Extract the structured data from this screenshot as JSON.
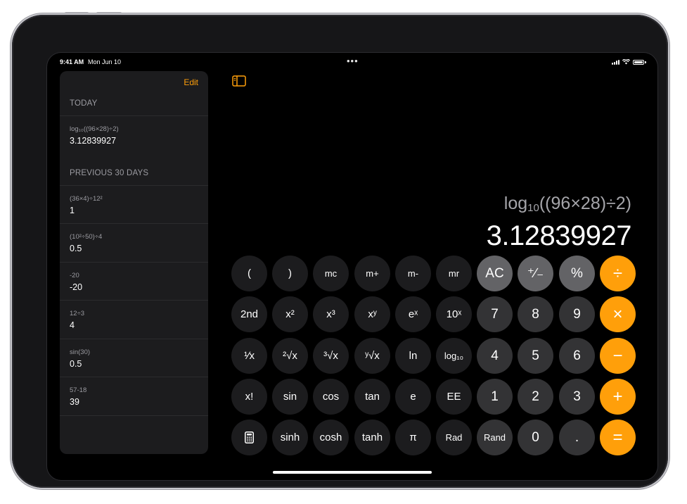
{
  "status_bar": {
    "time": "9:41 AM",
    "date": "Mon Jun 10"
  },
  "sidebar": {
    "edit_label": "Edit",
    "sections": [
      {
        "title": "TODAY",
        "items": [
          {
            "expression": "log₁₀((96×28)÷2)",
            "result": "3.12839927"
          }
        ]
      },
      {
        "title": "PREVIOUS 30 DAYS",
        "items": [
          {
            "expression": "(36×4)÷12²",
            "result": "1"
          },
          {
            "expression": "(10²÷50)÷4",
            "result": "0.5"
          },
          {
            "expression": "-20",
            "result": "-20"
          },
          {
            "expression": "12÷3",
            "result": "4"
          },
          {
            "expression": "sin(30)",
            "result": "0.5"
          },
          {
            "expression": "57-18",
            "result": "39"
          }
        ]
      }
    ]
  },
  "display": {
    "expression_main": "log",
    "expression_sub": "10",
    "expression_rest": "((96×28)÷2)",
    "result": "3.12839927"
  },
  "keypad": {
    "rows": [
      [
        "(",
        ")",
        "mc",
        "m+",
        "m-",
        "mr",
        "AC",
        "⁺∕₋",
        "%",
        "÷"
      ],
      [
        "2nd",
        "x²",
        "x³",
        "xʸ",
        "eˣ",
        "10ˣ",
        "7",
        "8",
        "9",
        "×"
      ],
      [
        "¹∕x",
        "²√x",
        "³√x",
        "ʸ√x",
        "ln",
        "log₁₀",
        "4",
        "5",
        "6",
        "−"
      ],
      [
        "x!",
        "sin",
        "cos",
        "tan",
        "e",
        "EE",
        "1",
        "2",
        "3",
        "+"
      ],
      [
        "",
        "sinh",
        "cosh",
        "tanh",
        "π",
        "Rad",
        "Rand",
        "0",
        ".",
        "="
      ]
    ]
  },
  "colors": {
    "accent": "#ff9f0a",
    "function_key": "#636366",
    "digit_key": "#333335",
    "scientific_key": "#1c1c1e",
    "sidebar_bg": "#1c1c1e"
  },
  "icons": {
    "sidebar_toggle": "sidebar-toggle-icon",
    "calculator_mode": "calculator-icon"
  }
}
